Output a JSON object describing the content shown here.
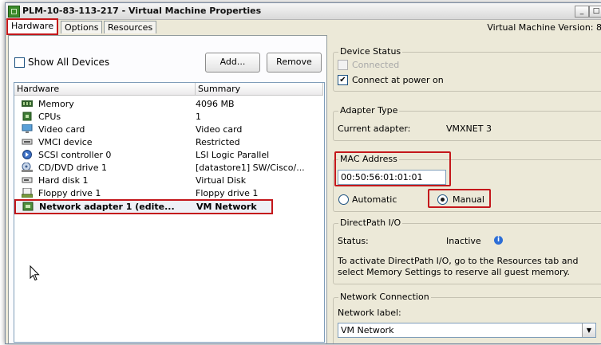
{
  "window": {
    "title": "PLM-10-83-113-217 - Virtual Machine Properties",
    "minimize_label": "_",
    "maximize_label": "□"
  },
  "tabs": [
    {
      "label": "Hardware",
      "active": true
    },
    {
      "label": "Options",
      "active": false
    },
    {
      "label": "Resources",
      "active": false
    }
  ],
  "vm_version": "Virtual Machine Version: 8",
  "left": {
    "show_all_devices": {
      "label": "Show All Devices",
      "checked": false
    },
    "add_button": "Add...",
    "remove_button": "Remove",
    "columns": [
      "Hardware",
      "Summary"
    ],
    "rows": [
      {
        "name": "Memory",
        "summary": "4096 MB",
        "icon": "memory-icon"
      },
      {
        "name": "CPUs",
        "summary": "1",
        "icon": "cpu-icon"
      },
      {
        "name": "Video card",
        "summary": "Video card",
        "icon": "monitor-icon"
      },
      {
        "name": "VMCI device",
        "summary": "Restricted",
        "icon": "vmci-device-icon"
      },
      {
        "name": "SCSI controller 0",
        "summary": "LSI Logic Parallel",
        "icon": "scsi-controller-icon"
      },
      {
        "name": "CD/DVD drive 1",
        "summary": "[datastore1] SW/Cisco/...",
        "icon": "cd-drive-icon"
      },
      {
        "name": "Hard disk 1",
        "summary": "Virtual Disk",
        "icon": "hard-disk-icon"
      },
      {
        "name": "Floppy drive 1",
        "summary": "Floppy drive 1",
        "icon": "floppy-icon"
      },
      {
        "name": "Network adapter 1 (edite...",
        "summary": "VM Network",
        "icon": "network-adapter-icon",
        "selected": true
      }
    ]
  },
  "device_status": {
    "title": "Device Status",
    "connected": {
      "label": "Connected",
      "checked": false,
      "disabled": true
    },
    "connect_at_power_on": {
      "label": "Connect at power on",
      "checked": true
    }
  },
  "adapter_type": {
    "title": "Adapter Type",
    "current_label": "Current adapter:",
    "current_value": "VMXNET 3"
  },
  "mac_address": {
    "title": "MAC Address",
    "value": "00:50:56:01:01:01",
    "automatic_label": "Automatic",
    "manual_label": "Manual",
    "selected": "Manual"
  },
  "directpath": {
    "title": "DirectPath I/O",
    "status_label": "Status:",
    "status_value": "Inactive",
    "note_line1": "To activate DirectPath I/O, go to the Resources tab and",
    "note_line2": "select Memory Settings to reserve all guest memory."
  },
  "network_connection": {
    "title": "Network Connection",
    "network_label": "Network label:",
    "selected_network": "VM Network"
  },
  "colors": {
    "highlight_red": "#c4171b",
    "window_bg": "#ece9d8",
    "info_blue": "#2d6ed6"
  }
}
